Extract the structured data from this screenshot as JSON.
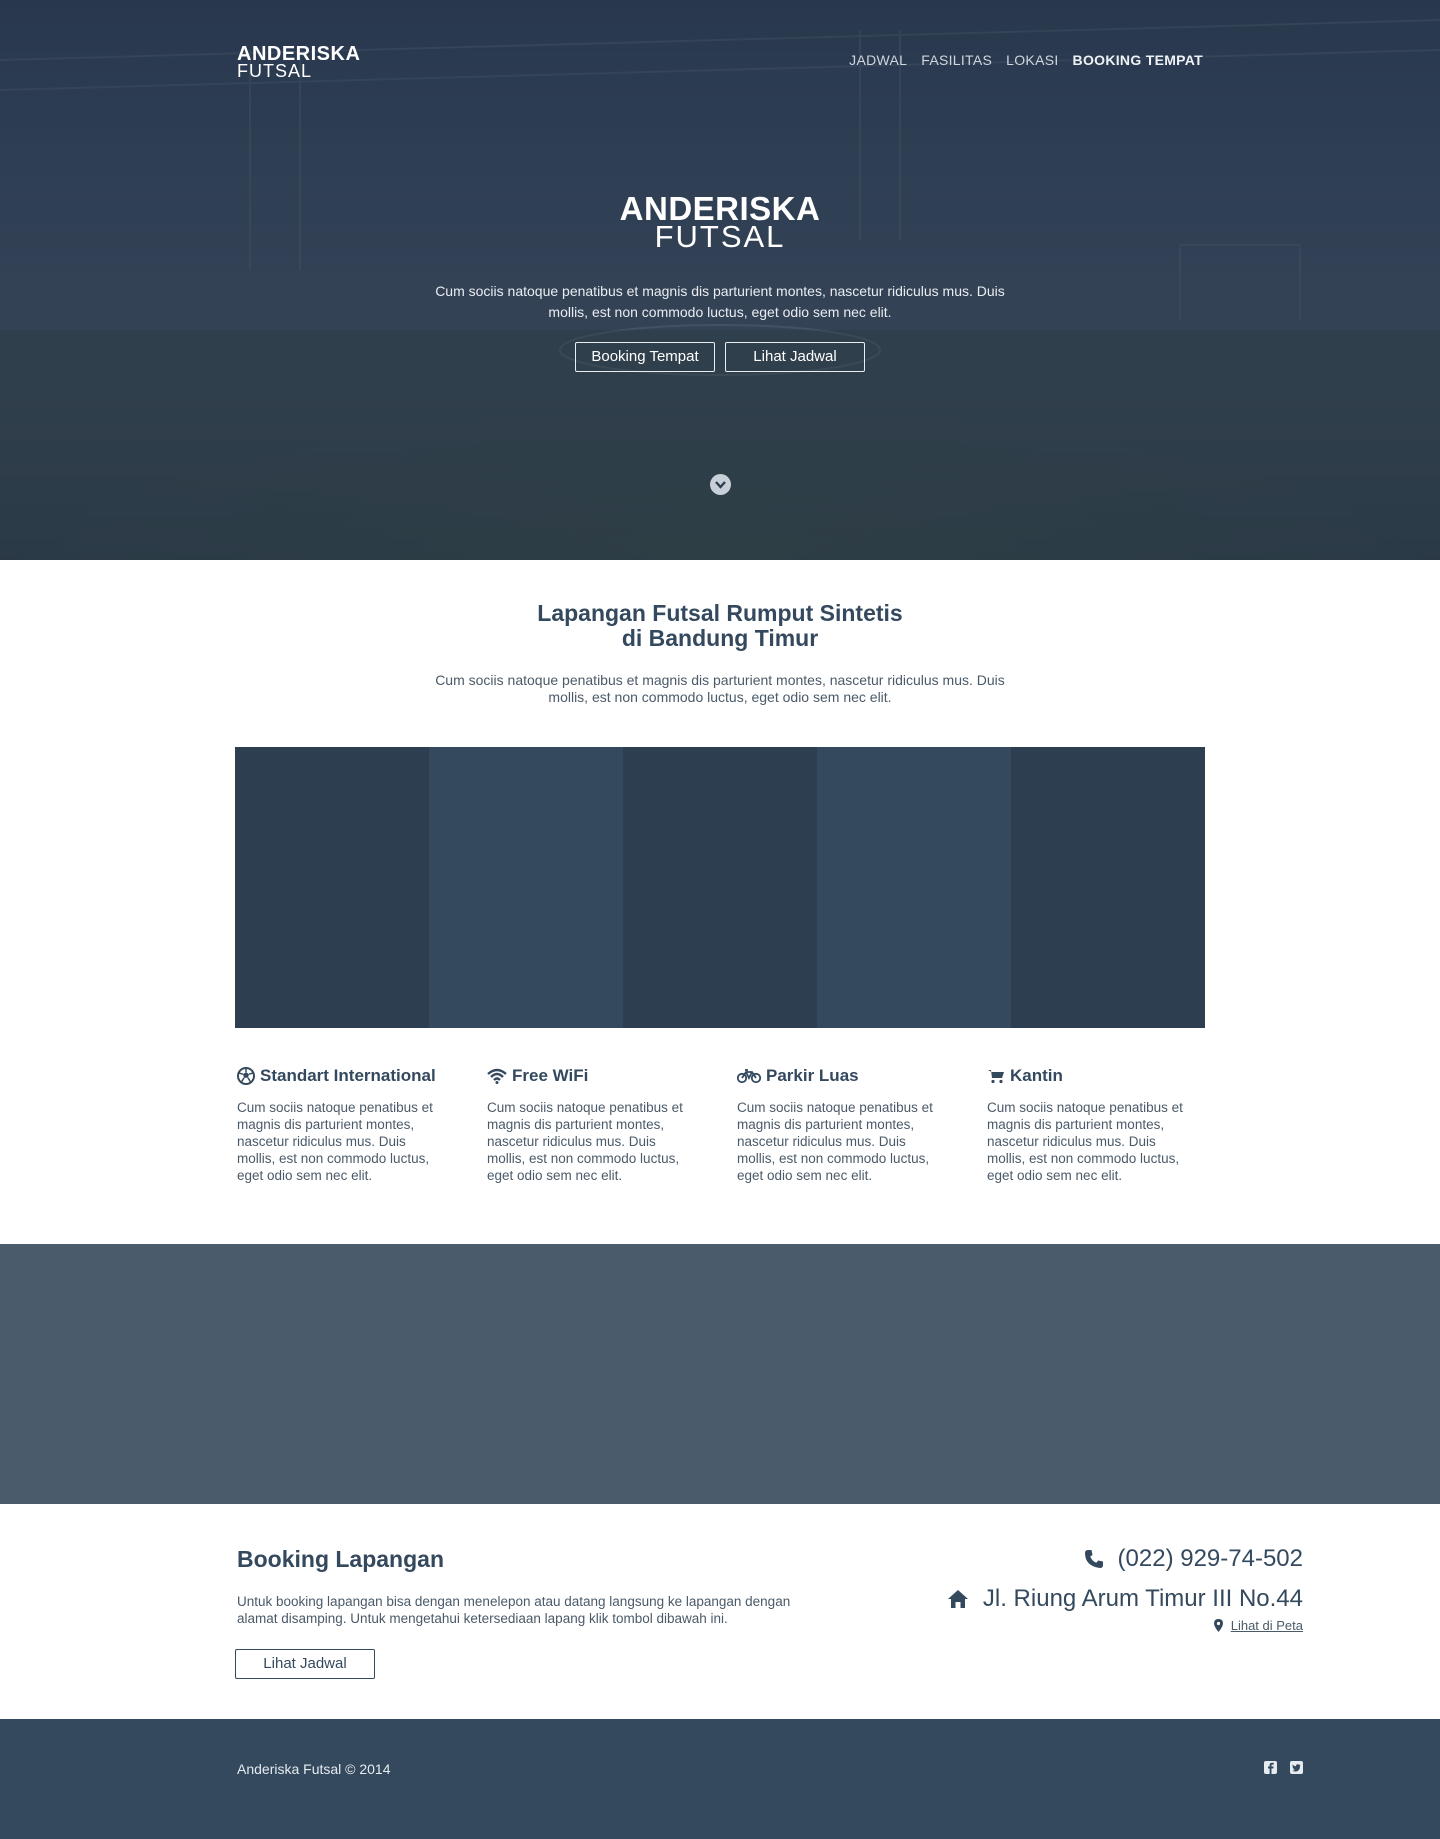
{
  "brand": {
    "line1": "ANDERISKA",
    "line2": "FUTSAL"
  },
  "nav": {
    "items": [
      {
        "label": "JADWAL"
      },
      {
        "label": "FASILITAS"
      },
      {
        "label": "LOKASI"
      },
      {
        "label": "BOOKING TEMPAT"
      }
    ]
  },
  "hero": {
    "title_line1": "ANDERISKA",
    "title_line2": "FUTSAL",
    "description": "Cum sociis natoque penatibus et magnis dis parturient montes, nascetur ridiculus mus. Duis mollis, est non commodo luctus, eget odio sem nec elit.",
    "buttons": {
      "booking": "Booking Tempat",
      "schedule": "Lihat Jadwal"
    },
    "scroll_icon": "chevron-down-circle-icon"
  },
  "intro": {
    "title_line1": "Lapangan Futsal Rumput Sintetis",
    "title_line2": "di Bandung Timur",
    "description": "Cum sociis natoque penatibus et magnis dis parturient montes, nascetur ridiculus mus. Duis mollis, est non commodo luctus, eget odio sem nec elit."
  },
  "gallery": {
    "tiles": [
      {
        "color": "#2c3e50"
      },
      {
        "color": "#34495e"
      },
      {
        "color": "#2c3e50"
      },
      {
        "color": "#34495e"
      },
      {
        "color": "#2c3e50"
      }
    ]
  },
  "features": [
    {
      "icon": "soccer-ball-icon",
      "title": "Standart International",
      "text": "Cum sociis natoque penatibus et magnis dis parturient montes, nascetur ridiculus mus. Duis mollis, est non commodo luctus, eget odio sem nec elit."
    },
    {
      "icon": "wifi-icon",
      "title": "Free WiFi",
      "text": "Cum sociis natoque penatibus et magnis dis parturient montes, nascetur ridiculus mus. Duis mollis, est non commodo luctus, eget odio sem nec elit."
    },
    {
      "icon": "bicycle-icon",
      "title": "Parkir Luas",
      "text": "Cum sociis natoque penatibus et magnis dis parturient montes, nascetur ridiculus mus. Duis mollis, est non commodo luctus, eget odio sem nec elit."
    },
    {
      "icon": "cart-icon",
      "title": "Kantin",
      "text": "Cum sociis natoque penatibus et magnis dis parturient montes, nascetur ridiculus mus. Duis mollis, est non commodo luctus, eget odio sem nec elit."
    }
  ],
  "booking": {
    "title": "Booking Lapangan",
    "description": "Untuk booking lapangan bisa dengan menelepon atau datang langsung ke lapangan dengan alamat disamping. Untuk mengetahui ketersediaan lapang klik tombol dibawah ini.",
    "button": "Lihat Jadwal",
    "phone": "(022) 929-74-502",
    "address": "Jl. Riung Arum Timur III No.44",
    "map_link": "Lihat di Peta"
  },
  "footer": {
    "copyright": "Anderiska Futsal © 2014",
    "social": [
      "facebook-icon",
      "twitter-icon"
    ]
  },
  "colors": {
    "primary": "#34495e",
    "dark": "#2c3e50",
    "band": "#4a5c6c"
  }
}
